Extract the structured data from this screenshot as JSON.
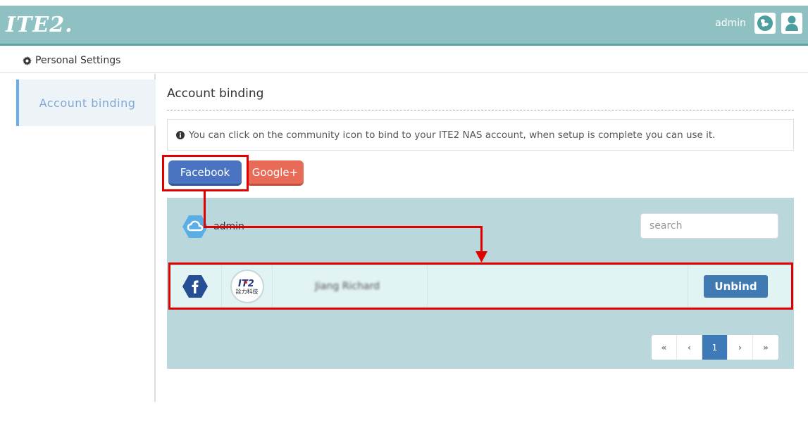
{
  "header": {
    "logo": "ITE2.",
    "user": "admin",
    "icons": [
      "globe-icon",
      "user-icon"
    ]
  },
  "subheader": {
    "title": "Personal Settings",
    "icon": "gear-icon"
  },
  "sidebar": {
    "items": [
      {
        "label": "Account binding",
        "active": true
      }
    ]
  },
  "main": {
    "title": "Account binding",
    "info": "You can click on the community icon to bind to your ITE2 NAS account, when setup is complete you can use it.",
    "buttons": {
      "facebook": "Facebook",
      "google": "Google+"
    },
    "panel": {
      "user": "admin",
      "search_placeholder": "search",
      "rows": [
        {
          "provider": "facebook",
          "avatar_text": "詮力科技",
          "name": "Jiang Richard",
          "action": "Unbind"
        }
      ],
      "pagination": {
        "first": "«",
        "prev": "‹",
        "current": "1",
        "next": "›",
        "last": "»"
      }
    }
  },
  "colors": {
    "header_bg": "#8fc1c3",
    "facebook": "#4a74c2",
    "google": "#e86b58",
    "panel_bg": "#bad8db",
    "row_bg": "#e2f3f3",
    "unbind": "#3f7ab3",
    "annotation": "#e00000"
  }
}
